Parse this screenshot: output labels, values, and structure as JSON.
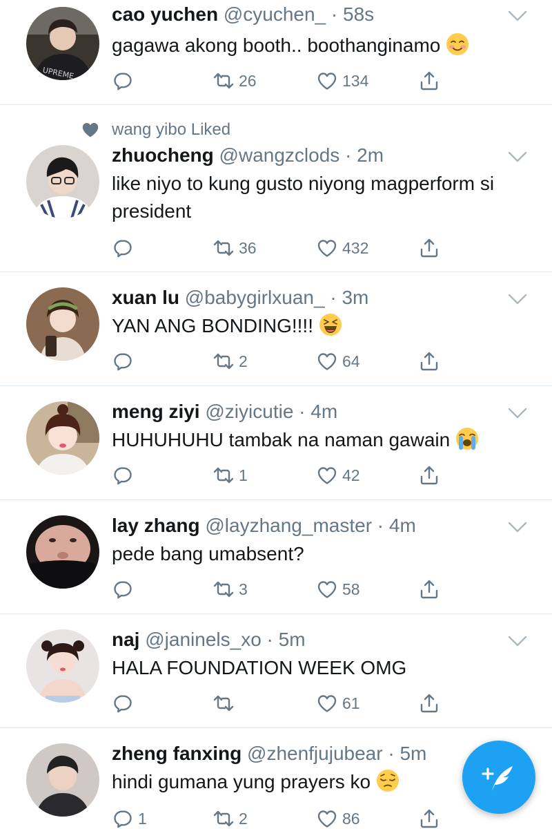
{
  "colors": {
    "accent": "#1da1f2",
    "text_primary": "#14171a",
    "text_secondary": "#657786",
    "divider": "#e1e8ed"
  },
  "tweets": [
    {
      "name": "cao yuchen",
      "handle": "@cyuchen_",
      "time": "58s",
      "text": "gagawa akong booth.. boothanginamo",
      "emoji": "smiling-face-icon",
      "replies": "",
      "retweets": "26",
      "likes": "134"
    },
    {
      "social_context": "wang yibo Liked",
      "name": "zhuocheng",
      "handle": "@wangzclods",
      "time": "2m",
      "text": "like niyo to kung gusto niyong magperform si president",
      "replies": "",
      "retweets": "36",
      "likes": "432"
    },
    {
      "name": "xuan lu",
      "handle": "@babygirlxuan_",
      "time": "3m",
      "text": "YAN ANG BONDING!!!!",
      "emoji": "laughing-face-icon",
      "replies": "",
      "retweets": "2",
      "likes": "64"
    },
    {
      "name": "meng ziyi",
      "handle": "@ziyicutie",
      "time": "4m",
      "text": "HUHUHUHU tambak na naman gawain",
      "emoji": "crying-face-icon",
      "replies": "",
      "retweets": "1",
      "likes": "42"
    },
    {
      "name": "lay zhang",
      "handle": "@layzhang_master",
      "time": "4m",
      "text": "pede bang umabsent?",
      "replies": "",
      "retweets": "3",
      "likes": "58"
    },
    {
      "name": "naj",
      "handle": "@janinels_xo",
      "time": "5m",
      "text": "HALA FOUNDATION WEEK OMG",
      "replies": "",
      "retweets": "",
      "likes": "61"
    },
    {
      "name": "zheng fanxing",
      "handle": "@zhenfjujubear",
      "time": "5m",
      "text": "hindi gumana yung prayers ko",
      "emoji": "pensive-face-icon",
      "replies": "1",
      "retweets": "2",
      "likes": "86"
    }
  ],
  "compose_button": {
    "icon": "compose-feather-icon"
  }
}
